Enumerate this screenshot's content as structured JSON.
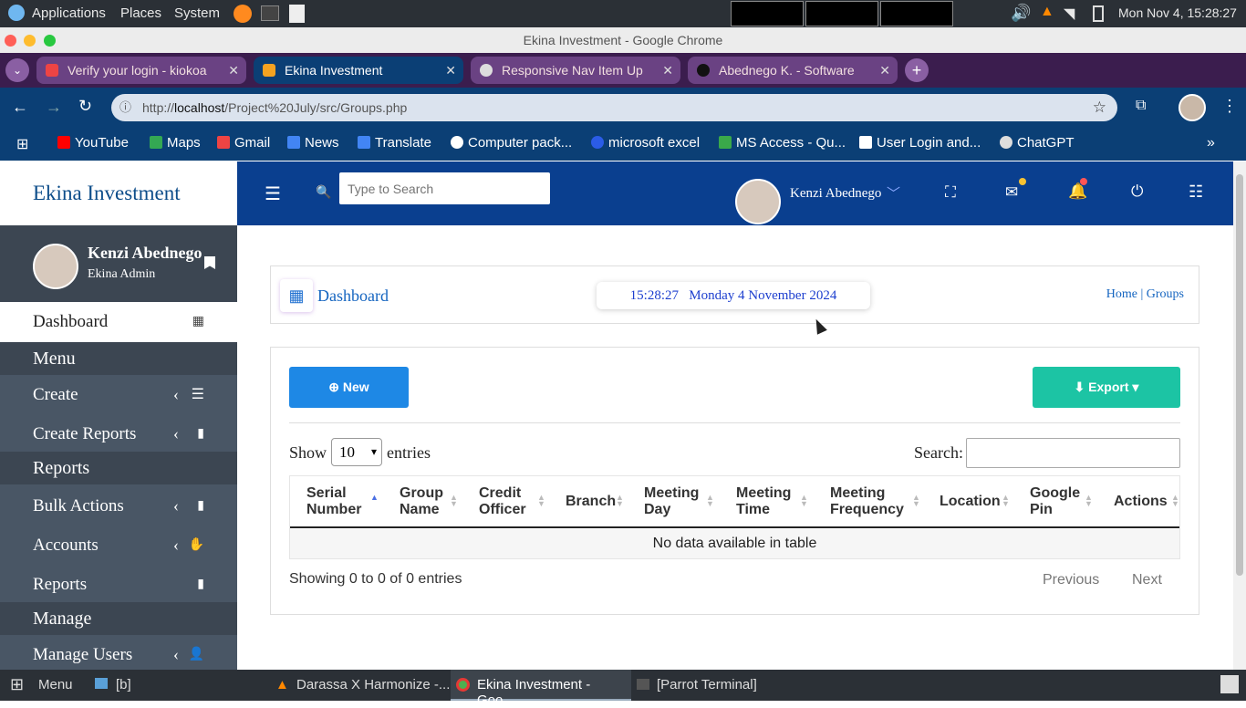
{
  "os": {
    "menu_applications": "Applications",
    "menu_places": "Places",
    "menu_system": "System",
    "clock": "Mon Nov 4, 15:28:27"
  },
  "window": {
    "title": "Ekina Investment - Google Chrome"
  },
  "tabs": [
    {
      "label": "Verify your login - kiokoa"
    },
    {
      "label": "Ekina Investment"
    },
    {
      "label": "Responsive Nav Item Up"
    },
    {
      "label": "Abednego K. - Software"
    }
  ],
  "address": {
    "url_prefix": "http://",
    "url_host": "localhost",
    "url_path": "/Project%20July/src/Groups.php"
  },
  "bookmarks": [
    "YouTube",
    "Maps",
    "Gmail",
    "News",
    "Translate",
    "Computer pack...",
    "microsoft excel",
    "MS Access - Qu...",
    "User Login and...",
    "ChatGPT"
  ],
  "sidebar": {
    "brand": "Ekina Investment",
    "user_name": "Kenzi Abednego",
    "user_role": "Ekina Admin",
    "dashboard": "Dashboard",
    "section_menu": "Menu",
    "create": "Create",
    "create_reports": "Create Reports",
    "section_reports": "Reports",
    "bulk_actions": "Bulk Actions",
    "accounts": "Accounts",
    "reports": "Reports",
    "section_manage": "Manage",
    "manage_users": "Manage Users"
  },
  "topnav": {
    "search_placeholder": "Type to Search",
    "user_name": "Kenzi Abednego"
  },
  "page": {
    "title": "Dashboard",
    "time": "15:28:27",
    "date": "Monday 4 November 2024",
    "crumb_home": "Home",
    "crumb_sep": "|",
    "crumb_current": "Groups"
  },
  "table": {
    "new_label": "New",
    "export_label": "Export",
    "show_label": "Show",
    "entries_value": "10",
    "entries_label": "entries",
    "search_label": "Search:",
    "columns": [
      {
        "l1": "Serial",
        "l2": "Number"
      },
      {
        "l1": "Group",
        "l2": "Name"
      },
      {
        "l1": "Credit",
        "l2": "Officer"
      },
      {
        "l1": "Branch",
        "l2": ""
      },
      {
        "l1": "Meeting",
        "l2": "Day"
      },
      {
        "l1": "Meeting",
        "l2": "Time"
      },
      {
        "l1": "Meeting",
        "l2": "Frequency"
      },
      {
        "l1": "Location",
        "l2": ""
      },
      {
        "l1": "Google",
        "l2": "Pin"
      },
      {
        "l1": "Actions",
        "l2": ""
      }
    ],
    "empty_text": "No data available in table",
    "info": "Showing 0 to 0 of 0 entries",
    "prev": "Previous",
    "next": "Next"
  },
  "taskbar": {
    "menu": "Menu",
    "files": "[b]",
    "items": [
      "Darassa X Harmonize  -...",
      "Ekina Investment - Goo...",
      "[Parrot Terminal]"
    ]
  },
  "colors": {
    "sidebar": "#495665",
    "topnav": "#0a3f8f",
    "new_button": "#1e88e5",
    "export_button": "#1cc4a4"
  }
}
